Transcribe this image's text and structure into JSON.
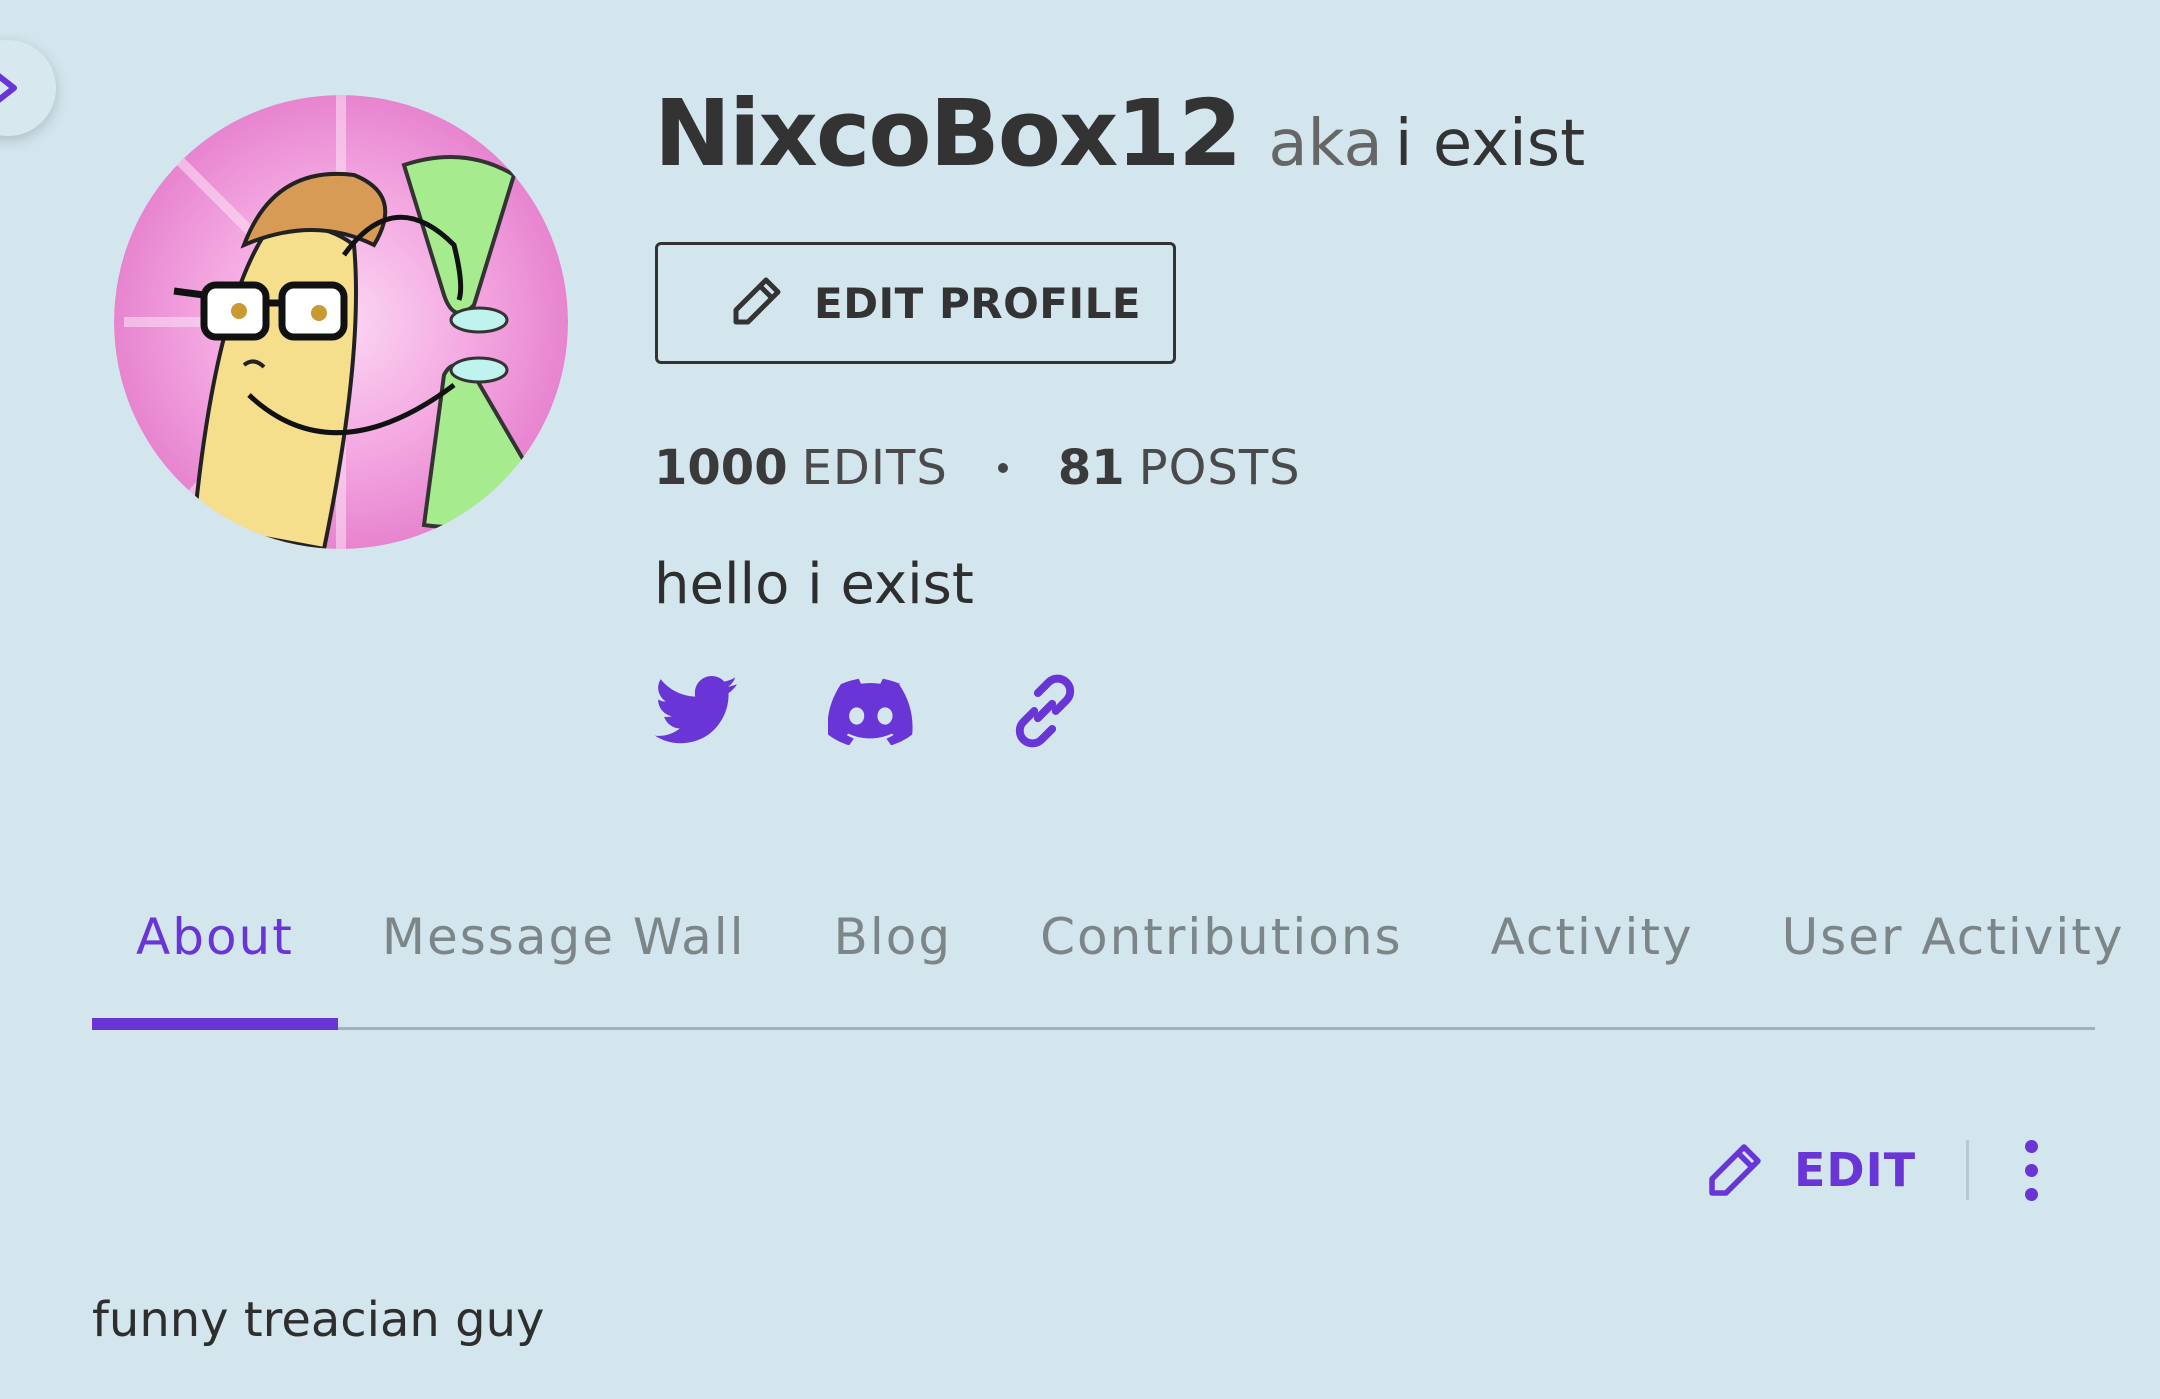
{
  "profile": {
    "username": "NixcoBox12",
    "aka_prefix": "aka",
    "aka_name": "i exist",
    "edit_profile_label": "EDIT PROFILE",
    "stats": {
      "edits_count": "1000",
      "edits_label": "EDITS",
      "posts_count": "81",
      "posts_label": "POSTS"
    },
    "bio": "hello i exist",
    "social_icons": [
      "twitter-icon",
      "discord-icon",
      "link-icon"
    ]
  },
  "tabs": [
    {
      "label": "About",
      "active": true
    },
    {
      "label": "Message Wall",
      "active": false
    },
    {
      "label": "Blog",
      "active": false
    },
    {
      "label": "Contributions",
      "active": false
    },
    {
      "label": "Activity",
      "active": false
    },
    {
      "label": "User Activity",
      "active": false
    }
  ],
  "about": {
    "edit_label": "EDIT",
    "text": "funny treacian guy"
  },
  "colors": {
    "background": "#d3e6ee",
    "accent": "#6a35d6",
    "text": "#2e2e2e",
    "muted_tab": "#7c8588"
  }
}
